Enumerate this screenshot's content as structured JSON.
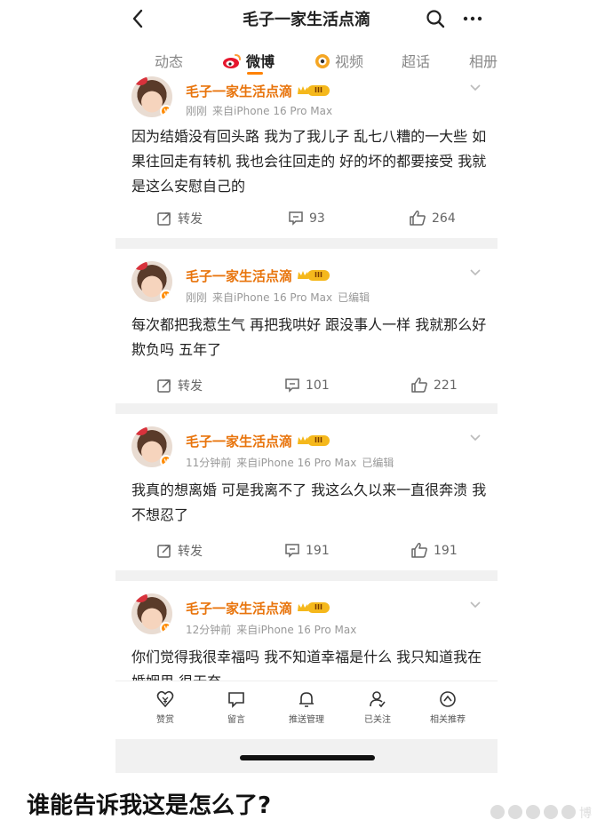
{
  "header": {
    "title": "毛子一家生活点滴",
    "back_icon": "chevron-left-icon",
    "search_icon": "search-icon",
    "more_icon": "more-dots-icon"
  },
  "tabs": [
    {
      "label": "动态",
      "active": false
    },
    {
      "label": "微博",
      "active": true,
      "icon": "weibo-logo-icon"
    },
    {
      "label": "视频",
      "active": false,
      "icon": "video-icon"
    },
    {
      "label": "超话",
      "active": false
    },
    {
      "label": "相册",
      "active": false
    }
  ],
  "accent_color": "#ff8200",
  "posts": [
    {
      "author": "毛子一家生活点滴",
      "level": "III",
      "time": "刚刚",
      "source": "来自iPhone 16 Pro Max",
      "edited": "",
      "text": "因为结婚没有回头路 我为了我儿子 乱七八糟的一大些 如果往回走有转机 我也会往回走的 好的坏的都要接受 我就是这么安慰自己的",
      "repost": "转发",
      "comments": "93",
      "likes": "264"
    },
    {
      "author": "毛子一家生活点滴",
      "level": "III",
      "time": "刚刚",
      "source": "来自iPhone 16 Pro Max",
      "edited": "已编辑",
      "text": "每次都把我惹生气 再把我哄好 跟没事人一样 我就那么好欺负吗 五年了",
      "repost": "转发",
      "comments": "101",
      "likes": "221"
    },
    {
      "author": "毛子一家生活点滴",
      "level": "III",
      "time": "11分钟前",
      "source": "来自iPhone 16 Pro Max",
      "edited": "已编辑",
      "text": "我真的想离婚 可是我离不了 我这么久以来一直很奔溃 我不想忍了",
      "repost": "转发",
      "comments": "191",
      "likes": "191"
    },
    {
      "author": "毛子一家生活点滴",
      "level": "III",
      "time": "12分钟前",
      "source": "来自iPhone 16 Pro Max",
      "edited": "",
      "text": "你们觉得我很幸福吗 我不知道幸福是什么 我只知道我在婚姻里 很无奈",
      "repost": "",
      "comments": "",
      "likes": ""
    }
  ],
  "bottom_bar": [
    {
      "label": "赞赏",
      "icon": "reward-icon"
    },
    {
      "label": "留言",
      "icon": "message-icon"
    },
    {
      "label": "推送管理",
      "icon": "bell-icon"
    },
    {
      "label": "已关注",
      "icon": "followed-user-icon"
    },
    {
      "label": "相关推荐",
      "icon": "recommend-icon"
    }
  ],
  "caption": "谁能告诉我这是怎么了?",
  "watermark": "博"
}
